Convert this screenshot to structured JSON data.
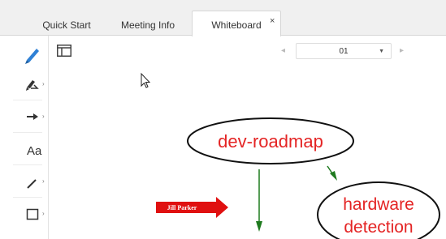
{
  "tabs": [
    {
      "label": "Quick Start"
    },
    {
      "label": "Meeting Info"
    },
    {
      "label": "Whiteboard",
      "close_symbol": "×"
    }
  ],
  "active_tab": "Whiteboard",
  "toolbar": {
    "tools": [
      "pen-icon",
      "pointer-arrow-icon",
      "arrow-icon",
      "text-icon",
      "line-icon",
      "rectangle-icon"
    ],
    "text_tool_label": "Aa",
    "accent_color": "#2f80d5"
  },
  "pager": {
    "page_value": "01",
    "prev_icon": "chevron-left-icon",
    "next_icon": "chevron-right-icon"
  },
  "whiteboard": {
    "shapes": [
      {
        "text_lines": [
          "dev-roadmap"
        ],
        "text_color": "#e42424",
        "icon": "ellipse-shape"
      },
      {
        "text_lines": [
          "hardware",
          "detection"
        ],
        "text_color": "#e42424",
        "icon": "ellipse-shape"
      }
    ],
    "pointer_label": "Jill Parker",
    "pointer_color": "#e01010",
    "arrow_color": "#1e7a1e"
  }
}
